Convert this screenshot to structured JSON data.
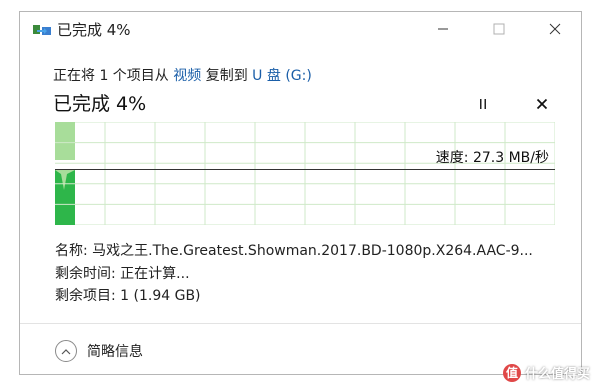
{
  "window": {
    "title": "已完成 4%"
  },
  "copy_line": {
    "prefix": "正在将 1 个项目从 ",
    "source": "视频",
    "middle": " 复制到 ",
    "destination": "U 盘 (G:)"
  },
  "progress": {
    "title": "已完成 4%",
    "percent": 4,
    "pause_label": "II",
    "cancel_label": "✕"
  },
  "graph": {
    "speed_text": "速度: 27.3 MB/秒",
    "fill_color": "#4caf50",
    "light_fill_color": "#a8dd9a",
    "grid_color": "#cfe9c8"
  },
  "details": {
    "name": "名称: 马戏之王.The.Greatest.Showman.2017.BD-1080p.X264.AAC-9...",
    "time_remaining": "剩余时间: 正在计算...",
    "items_remaining": "剩余项目: 1 (1.94 GB)"
  },
  "footer": {
    "label": "简略信息"
  },
  "watermark": {
    "badge": "值",
    "text": "什么值得买"
  }
}
